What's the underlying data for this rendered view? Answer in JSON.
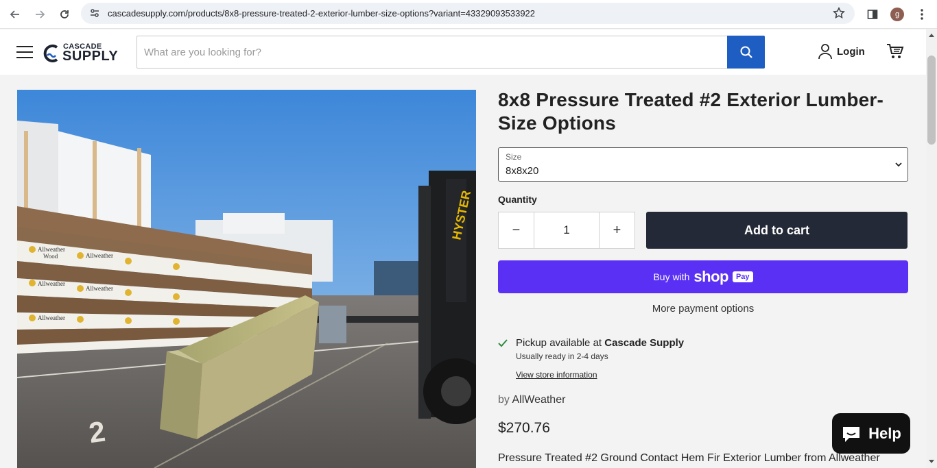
{
  "browser": {
    "url": "cascadesupply.com/products/8x8-pressure-treated-2-exterior-lumber-size-options?variant=43329093533922",
    "profile_initial": "g"
  },
  "header": {
    "logo_line1": "CASCADE",
    "logo_line2": "SUPPLY",
    "search_placeholder": "What are you looking for?",
    "login_label": "Login"
  },
  "product": {
    "title": "8x8 Pressure Treated #2 Exterior Lumber- Size Options",
    "size_label": "Size",
    "size_value": "8x8x20",
    "quantity_label": "Quantity",
    "quantity_value": "1",
    "minus_symbol": "−",
    "plus_symbol": "+",
    "add_to_cart_label": "Add to cart",
    "buy_with": "Buy with",
    "shop_word": "shop",
    "pay_word": "Pay",
    "more_payment_label": "More payment options",
    "pickup_prefix": "Pickup available at",
    "pickup_store": "Cascade Supply",
    "pickup_ready": "Usually ready in 2-4 days",
    "store_info_link": "View store information",
    "vendor_prefix": "by",
    "vendor": "AllWeather",
    "price": "$270.76",
    "description": "Pressure Treated #2 Ground Contact Hem Fir Exterior Lumber from Allweather"
  },
  "photo": {
    "forklift_brand": "HYSTER",
    "wrap_brand_1": "Allweather",
    "wrap_brand_2": "Wood",
    "ground_number": "2"
  },
  "chat": {
    "help_label": "Help"
  },
  "colors": {
    "accent_blue": "#1e5ec2",
    "add_to_cart_bg": "#232936",
    "shop_pay_purple": "#5a31f4",
    "pickup_check_green": "#2e8b3f"
  }
}
